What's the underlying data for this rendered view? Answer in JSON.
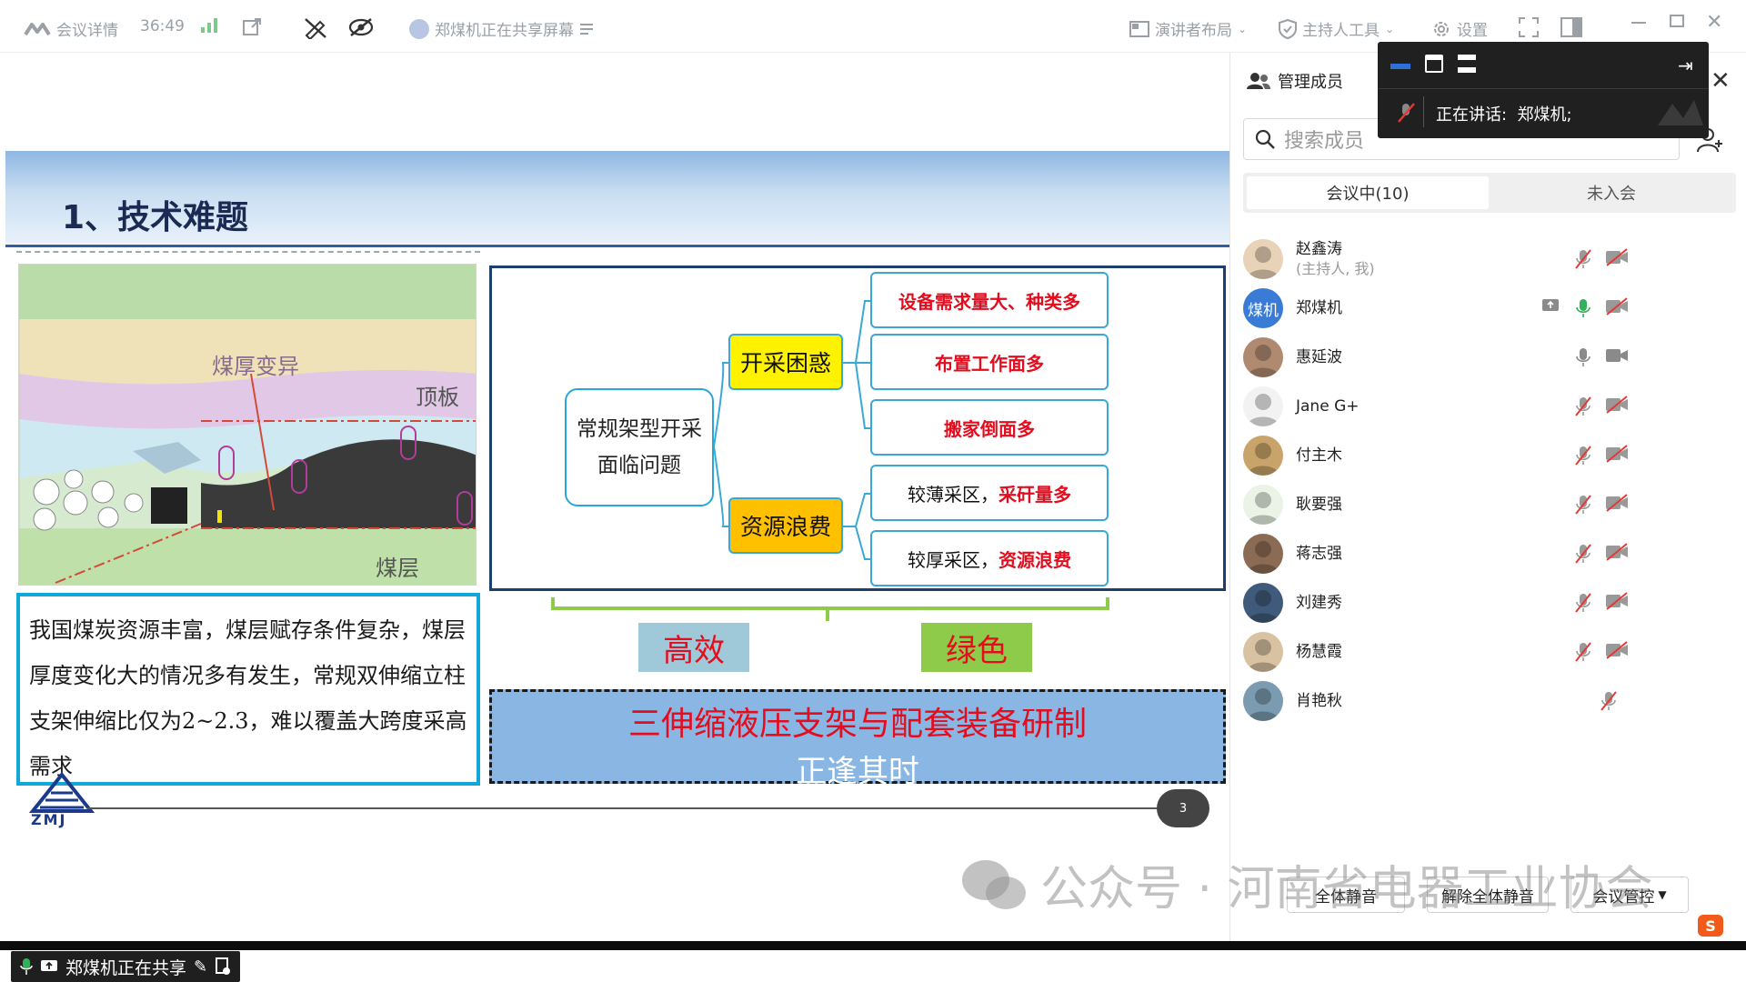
{
  "topbar": {
    "meeting_info": "会议详情",
    "duration": "36:49",
    "sharing_notice": "郑煤机正在共享屏幕",
    "presenter_layout": "演讲者布局",
    "host_tools": "主持人工具",
    "settings": "设置"
  },
  "slide": {
    "title": "1、技术难题",
    "figure_labels": {
      "coal_thickness": "煤厚变异",
      "roof": "顶板",
      "seam": "煤层"
    },
    "description": "我国煤炭资源丰富，煤层赋存条件复杂，煤层厚度变化大的情况多有发生，常规双伸缩立柱支架伸缩比仅为2~2.3，难以覆盖大跨度采高需求",
    "mindmap": {
      "root": "常规架型开采面临问题",
      "branches": [
        {
          "label": "开采困惑",
          "color": "#fff200",
          "leaves": [
            {
              "pre": "",
              "red": "设备需求量大、种类多"
            },
            {
              "pre": "",
              "red": "布置工作面多"
            },
            {
              "pre": "",
              "red": "搬家倒面多"
            }
          ]
        },
        {
          "label": "资源浪费",
          "color": "#ffc000",
          "leaves": [
            {
              "pre": "较薄采区，",
              "red": "采矸量多"
            },
            {
              "pre": "较厚采区，",
              "red": "资源浪费"
            }
          ]
        }
      ]
    },
    "tag_efficient": "高效",
    "tag_green": "绿色",
    "banner_line1": "三伸缩液压支架与配套装备研制",
    "banner_line2": "正逢其时",
    "logo_text": "ZMJ",
    "page_number": "3"
  },
  "share_pill": "郑煤机正在共享",
  "watermark": "公众号 · 河南省电器工业协会",
  "panel": {
    "title": "管理成员",
    "search_placeholder": "搜索成员",
    "tab_in_meeting": "会议中(10)",
    "tab_not_joined": "未入会",
    "members": [
      {
        "name": "赵鑫涛",
        "note": "(主持人, 我)",
        "avatar_color": "#e8d3b8",
        "mic": "muted",
        "cam": "off"
      },
      {
        "name": "郑煤机",
        "note": "",
        "avatar_color": "#3a7bd5",
        "avatar_text": "煤机",
        "mic": "on",
        "cam": "off",
        "sharing": true
      },
      {
        "name": "惠延波",
        "note": "",
        "avatar_color": "#b08a70",
        "mic": "idle",
        "cam": "on"
      },
      {
        "name": "Jane G+",
        "note": "",
        "avatar_color": "#f2f2f2",
        "mic": "muted",
        "cam": "off"
      },
      {
        "name": "付主木",
        "note": "",
        "avatar_color": "#c9a46a",
        "mic": "muted",
        "cam": "off"
      },
      {
        "name": "耿要强",
        "note": "",
        "avatar_color": "#eaf3e6",
        "mic": "muted",
        "cam": "off"
      },
      {
        "name": "蒋志强",
        "note": "",
        "avatar_color": "#8c6b55",
        "mic": "muted",
        "cam": "off"
      },
      {
        "name": "刘建秀",
        "note": "",
        "avatar_color": "#3f5a7a",
        "mic": "muted",
        "cam": "off"
      },
      {
        "name": "杨慧霞",
        "note": "",
        "avatar_color": "#d9c2a2",
        "mic": "muted",
        "cam": "off"
      },
      {
        "name": "肖艳秋",
        "note": "",
        "avatar_color": "#7a9bb0",
        "mic": "muted",
        "cam": "none"
      }
    ],
    "btn_mute_all": "全体静音",
    "btn_unmute_all": "解除全体静音",
    "btn_control": "会议管控"
  },
  "speaker_overlay": {
    "label": "正在讲话:",
    "speaker": "郑煤机;"
  },
  "colors": {
    "mic_on": "#33b15a",
    "muted_red": "#e53935",
    "accent_blue": "#2f6fd8"
  }
}
